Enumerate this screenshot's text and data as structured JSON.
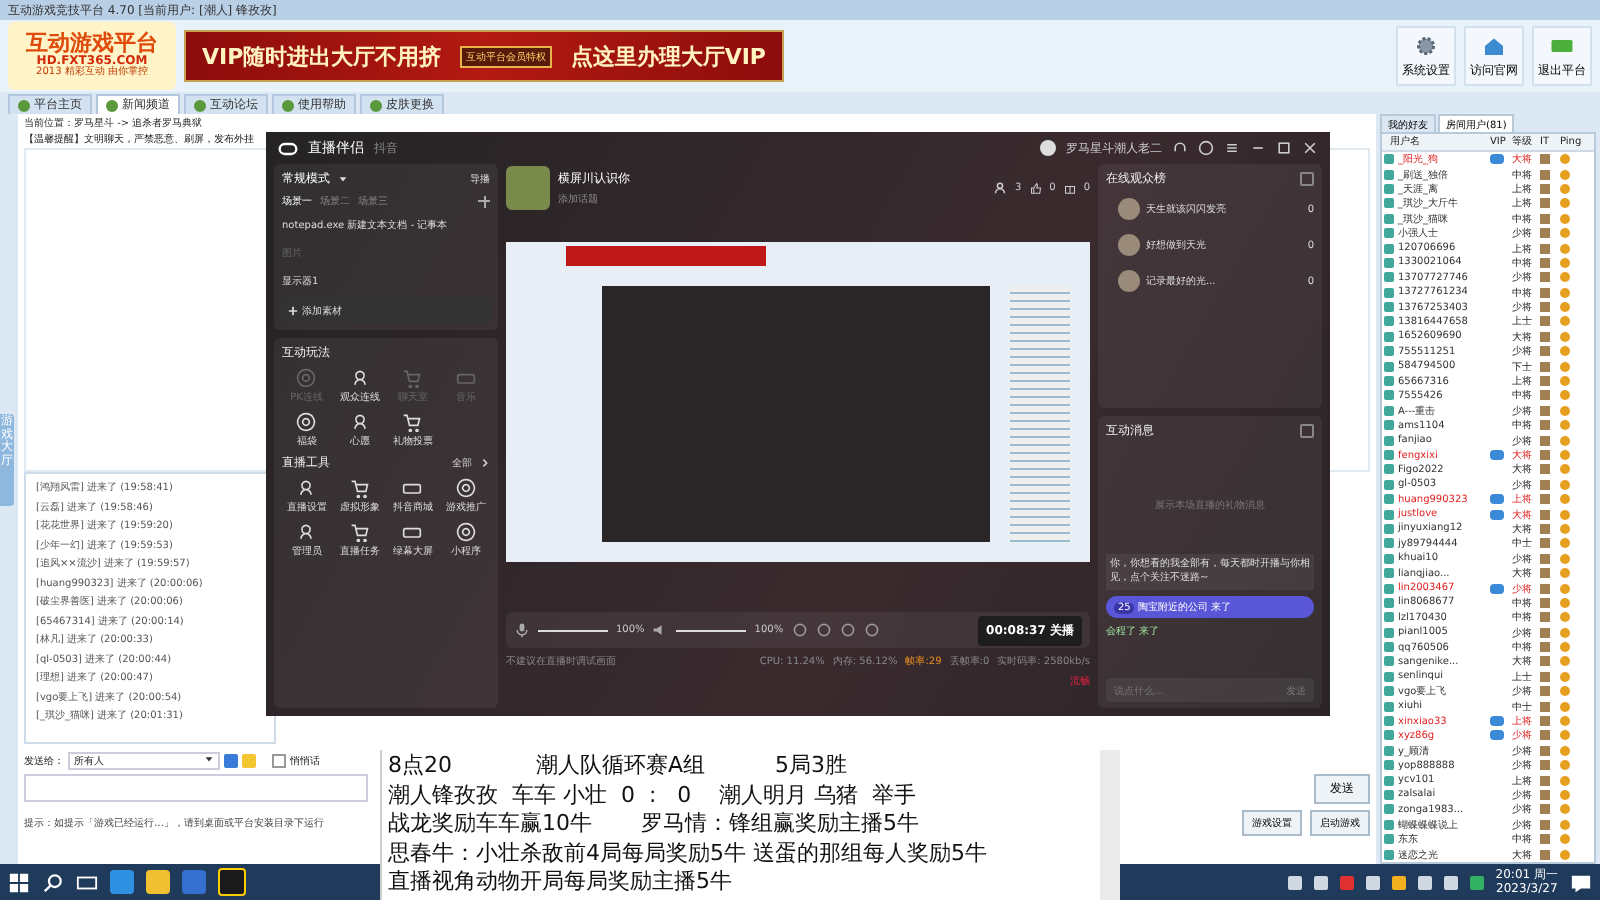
{
  "window": {
    "title": "互动游戏竞技平台 4.70 [当前用户: [潮人] 锋孜孜]"
  },
  "logo": {
    "name": "互动游戏平台",
    "url": "HD.FXT365.COM",
    "slogan": "2013 精彩互动 由你掌控"
  },
  "banner": {
    "left": "VIP随时进出大厅不用挤",
    "badge": "互动平台会员特权",
    "right": "点这里办理大厅VIP"
  },
  "header_buttons": [
    {
      "label": "系统设置",
      "kind": "gear"
    },
    {
      "label": "访问官网",
      "kind": "house"
    },
    {
      "label": "退出平台",
      "kind": "exit"
    }
  ],
  "tabs": [
    {
      "label": "平台主页",
      "selected": false
    },
    {
      "label": "新闻频道",
      "selected": true
    },
    {
      "label": "互动论坛",
      "selected": false
    },
    {
      "label": "使用帮助",
      "selected": false
    },
    {
      "label": "皮肤更换",
      "selected": false
    }
  ],
  "breadcrumb": "当前位置：罗马星斗 -> 追杀者罗马典狱",
  "notice": "【温馨提醒】文明聊天，严禁恶意、刷屏，发布外挂",
  "side_tab": "游戏大厅",
  "join_messages": [
    {
      "name": "[鸿翔风雷]",
      "text": "进来了",
      "time": "(19:58:41)"
    },
    {
      "name": "[云磊]",
      "text": "进来了",
      "time": "(19:58:46)"
    },
    {
      "name": "[花花世界]",
      "text": "进来了",
      "time": "(19:59:20)"
    },
    {
      "name": "[少年一幻]",
      "text": "进来了",
      "time": "(19:59:53)"
    },
    {
      "name": "[追风××流沙]",
      "text": "进来了",
      "time": "(19:59:57)"
    },
    {
      "name": "[huang990323]",
      "text": "进来了",
      "time": "(20:00:06)"
    },
    {
      "name": "[破尘界善医]",
      "text": "进来了",
      "time": "(20:00:06)"
    },
    {
      "name": "[65467314]",
      "text": "进来了",
      "time": "(20:00:14)"
    },
    {
      "name": "[林凡]",
      "text": "进来了",
      "time": "(20:00:33)"
    },
    {
      "name": "[ql-0503]",
      "text": "进来了",
      "time": "(20:00:44)"
    },
    {
      "name": "[理想]",
      "text": "进来了",
      "time": "(20:00:47)"
    },
    {
      "name": "[vgo要上飞]",
      "text": "进来了",
      "time": "(20:00:54)"
    },
    {
      "name": "[_琪沙_猫咪]",
      "text": "进来了",
      "time": "(20:01:31)"
    }
  ],
  "send": {
    "label": "发送给：",
    "target": "所有人",
    "whisper": {
      "label": "悄悄话",
      "checked": false
    },
    "button": "发送",
    "tip": "提示：如提示「游戏已经运行…」，请到桌面或平台安装目录下运行",
    "buttons": [
      "游戏设置",
      "启动游戏"
    ]
  },
  "live_app": {
    "title": "直播伴侣",
    "platform": "抖音",
    "account": "罗马星斗潮人老二",
    "mode": "常规模式",
    "mode_action": "导播",
    "scenes": [
      {
        "label": "场景一",
        "selected": true
      },
      {
        "label": "场景二",
        "selected": false
      },
      {
        "label": "场景三",
        "selected": false
      }
    ],
    "sources": [
      {
        "label": "notepad.exe 新建文本文档 - 记事本",
        "visible": true
      },
      {
        "label": "图片",
        "visible": false
      },
      {
        "label": "显示器1",
        "visible": true
      }
    ],
    "add_source": "添加素材",
    "interactive": {
      "title": "互动玩法",
      "items": [
        {
          "label": "PK连线",
          "disabled": true
        },
        {
          "label": "观众连线",
          "disabled": false
        },
        {
          "label": "聊天室",
          "disabled": true
        },
        {
          "label": "音乐",
          "disabled": true
        },
        {
          "label": "福袋",
          "disabled": false
        },
        {
          "label": "心愿",
          "disabled": false
        },
        {
          "label": "礼物投票",
          "disabled": false
        }
      ]
    },
    "tools": {
      "title": "直播工具",
      "more": "全部",
      "items": [
        {
          "label": "直播设置"
        },
        {
          "label": "虚拟形象"
        },
        {
          "label": "抖音商城"
        },
        {
          "label": "游戏推广"
        },
        {
          "label": "管理员"
        },
        {
          "label": "直播任务"
        },
        {
          "label": "绿幕大屏"
        },
        {
          "label": "小程序"
        }
      ]
    },
    "room": {
      "title": "横屏川认识你",
      "subtitle": "添加话题",
      "viewers": "3",
      "likes": "0",
      "gifts": "0"
    },
    "controls": {
      "mic": {
        "level": 1,
        "reading": "100%"
      },
      "speaker": {
        "level": 1,
        "reading": "100%"
      },
      "timer": "00:08:37",
      "end": "关播"
    },
    "status": {
      "hint": "不建议在直播时调试画面",
      "items": [
        {
          "text": "CPU: 11.24%",
          "warn": false
        },
        {
          "text": "内存: 56.12%",
          "warn": false
        },
        {
          "text": "帧率:29",
          "warn": true
        },
        {
          "text": "丢帧率:0",
          "warn": false
        },
        {
          "text": "实时码率: 2580kb/s",
          "warn": false
        }
      ],
      "quality": "流畅"
    },
    "audience": {
      "title": "在线观众榜",
      "viewers": [
        {
          "name": "天生就该闪闪发亮",
          "score": "0"
        },
        {
          "name": "好想做到天光",
          "score": "0"
        },
        {
          "name": "记录最好的光...",
          "score": "0"
        }
      ]
    },
    "messages": {
      "title": "互动消息",
      "empty": "展示本场直播的礼物消息",
      "welcome": "你，你想看的我全部有，每天都时开播与你相见，点个关注不迷路~",
      "entries": [
        {
          "badge": "25",
          "name": "陶宝附近的公司",
          "action": "来了",
          "highlight": true
        },
        {
          "name": "会程了",
          "action": "来了",
          "highlight": false
        }
      ],
      "placeholder": "说点什么...",
      "send": "发送"
    }
  },
  "user_list": {
    "tabs": [
      {
        "label": "我的好友",
        "selected": false
      },
      {
        "label": "房间用户(81)",
        "selected": true
      }
    ],
    "columns": [
      "用户名",
      "VIP",
      "等级",
      "IT",
      "Ping"
    ],
    "rows": [
      {
        "name": "_阳光_狗",
        "vip": true,
        "level": "大将"
      },
      {
        "name": "_刷送_独倍",
        "vip": false,
        "level": "中将"
      },
      {
        "name": "_天涯_离",
        "vip": false,
        "level": "上将"
      },
      {
        "name": "_琪沙_大斤牛",
        "vip": false,
        "level": "上将"
      },
      {
        "name": "_琪沙_猫咪",
        "vip": false,
        "level": "中将"
      },
      {
        "name": "小强人士",
        "vip": false,
        "level": "少将"
      },
      {
        "name": "120706696",
        "vip": false,
        "level": "上将"
      },
      {
        "name": "1330021064",
        "vip": false,
        "level": "中将"
      },
      {
        "name": "13707727746",
        "vip": false,
        "level": "少将"
      },
      {
        "name": "13727761234",
        "vip": false,
        "level": "中将"
      },
      {
        "name": "13767253403",
        "vip": false,
        "level": "少将"
      },
      {
        "name": "13816447658",
        "vip": false,
        "level": "上士"
      },
      {
        "name": "1652609690",
        "vip": false,
        "level": "大将"
      },
      {
        "name": "755511251",
        "vip": false,
        "level": "少将"
      },
      {
        "name": "584794500",
        "vip": false,
        "level": "下士"
      },
      {
        "name": "65667316",
        "vip": false,
        "level": "上将"
      },
      {
        "name": "7555426",
        "vip": false,
        "level": "中将"
      },
      {
        "name": "A---重击",
        "vip": false,
        "level": "少将"
      },
      {
        "name": "ams1104",
        "vip": false,
        "level": "中将"
      },
      {
        "name": "fanjiao",
        "vip": false,
        "level": "少将"
      },
      {
        "name": "fengxixi",
        "vip": true,
        "level": "大将"
      },
      {
        "name": "Figo2022",
        "vip": false,
        "level": "大将"
      },
      {
        "name": "gl-0503",
        "vip": false,
        "level": "少将"
      },
      {
        "name": "huang990323",
        "vip": true,
        "level": "上将"
      },
      {
        "name": "justlove",
        "vip": true,
        "level": "大将"
      },
      {
        "name": "jinyuxiang12",
        "vip": false,
        "level": "大将"
      },
      {
        "name": "jy89794444",
        "vip": false,
        "level": "中士"
      },
      {
        "name": "khuai10",
        "vip": false,
        "level": "少将"
      },
      {
        "name": "lianqjiao...",
        "vip": false,
        "level": "大将"
      },
      {
        "name": "lin2003467",
        "vip": true,
        "level": "少将"
      },
      {
        "name": "lin8068677",
        "vip": false,
        "level": "中将"
      },
      {
        "name": "lzl170430",
        "vip": false,
        "level": "中将"
      },
      {
        "name": "pianl1005",
        "vip": false,
        "level": "少将"
      },
      {
        "name": "qq760506",
        "vip": false,
        "level": "中将"
      },
      {
        "name": "sangenike...",
        "vip": false,
        "level": "大将"
      },
      {
        "name": "senlinqui",
        "vip": false,
        "level": "上士"
      },
      {
        "name": "vgo要上飞",
        "vip": false,
        "level": "少将"
      },
      {
        "name": "xiuhi",
        "vip": false,
        "level": "中士"
      },
      {
        "name": "xinxiao33",
        "vip": true,
        "level": "上将"
      },
      {
        "name": "xyz86g",
        "vip": true,
        "level": "少将"
      },
      {
        "name": "y_顾清",
        "vip": false,
        "level": "少将"
      },
      {
        "name": "yop888888",
        "vip": false,
        "level": "少将"
      },
      {
        "name": "ycv101",
        "vip": false,
        "level": "上将"
      },
      {
        "name": "zalsalai",
        "vip": false,
        "level": "少将"
      },
      {
        "name": "zonga1983...",
        "vip": false,
        "level": "少将"
      },
      {
        "name": "蝴蝶蝶蝶说上",
        "vip": false,
        "level": "少将"
      },
      {
        "name": "东东",
        "vip": false,
        "level": "中将"
      },
      {
        "name": "迷恋之光",
        "vip": false,
        "level": "大将"
      }
    ]
  },
  "notepad": {
    "lines": [
      "8点20            潮人队循环赛A组          5局3胜",
      "潮人锋孜孜  车车 小壮  0  :   0    潮人明月 乌猪  举手",
      "战龙奖励车车赢10牛       罗马情：锋组赢奖励主播5牛",
      "思春牛：小壮杀敌前4局每局奖励5牛 送蛋的那组每人奖励5牛",
      "直播视角动物开局每局奖励主播5牛"
    ]
  },
  "taskbar": {
    "time": "20:01 周一",
    "date": "2023/3/27"
  }
}
